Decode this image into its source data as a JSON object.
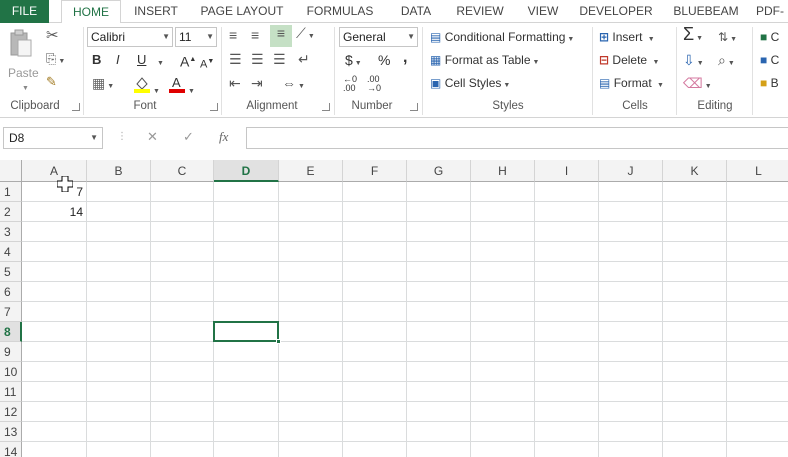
{
  "tabs": [
    "FILE",
    "HOME",
    "INSERT",
    "PAGE LAYOUT",
    "FORMULAS",
    "DATA",
    "REVIEW",
    "VIEW",
    "DEVELOPER",
    "BLUEBEAM",
    "PDF-"
  ],
  "active_tab": "HOME",
  "clipboard": {
    "paste_label": "Paste",
    "group_label": "Clipboard"
  },
  "font": {
    "name": "Calibri",
    "size": "11",
    "group_label": "Font",
    "bold": "B",
    "italic": "I",
    "underline": "U",
    "grow": "A",
    "shrink": "A"
  },
  "alignment": {
    "group_label": "Alignment"
  },
  "number": {
    "format": "General",
    "currency": "$",
    "percent": "%",
    "comma": ",",
    "inc_decimal": ".00",
    "dec_decimal": ".00",
    "group_label": "Number"
  },
  "styles": {
    "conditional": "Conditional Formatting",
    "format_table": "Format as Table",
    "cell_styles": "Cell Styles",
    "group_label": "Styles"
  },
  "cells": {
    "insert": "Insert",
    "delete": "Delete",
    "format": "Format",
    "group_label": "Cells"
  },
  "editing": {
    "group_label": "Editing",
    "sigma": "Σ"
  },
  "overflow": {
    "item1": "C",
    "item2": "C",
    "item3": "B"
  },
  "formula_bar": {
    "name_box": "D8",
    "cancel": "✕",
    "enter": "✓",
    "fx": "fx",
    "value": ""
  },
  "columns": [
    "A",
    "B",
    "C",
    "D",
    "E",
    "F",
    "G",
    "H",
    "I",
    "J",
    "K",
    "L"
  ],
  "selected_column": "D",
  "rows": [
    "1",
    "2",
    "3",
    "4",
    "5",
    "6",
    "7",
    "8",
    "9",
    "10",
    "11",
    "12",
    "13",
    "14"
  ],
  "selected_row": "8",
  "cells_data": {
    "A1": "7",
    "A2": "14"
  }
}
